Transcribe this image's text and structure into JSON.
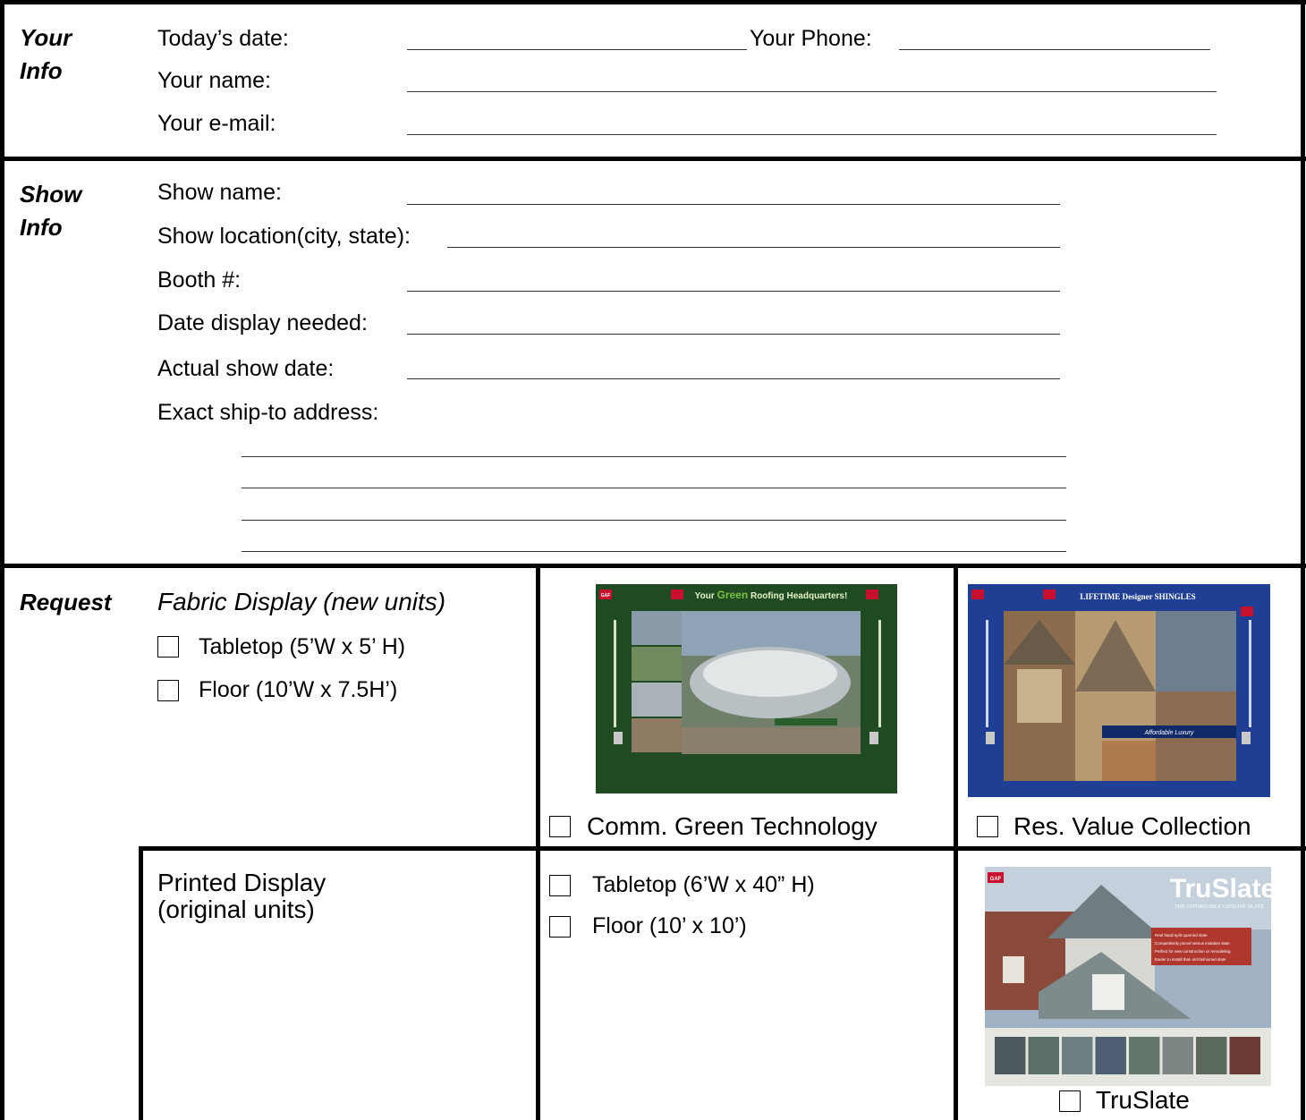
{
  "your_info": {
    "label": "Your\nInfo",
    "todays_date": "Today’s date:",
    "your_phone": "Your Phone:",
    "your_name": "Your name:",
    "your_email": "Your e-mail:"
  },
  "show_info": {
    "label": "Show\nInfo",
    "show_name": "Show name:",
    "show_location": "Show location(city, state):",
    "booth": "Booth #:",
    "date_display_needed": "Date display needed:",
    "actual_show_date": "Actual show date:",
    "ship_to": "Exact ship-to address:"
  },
  "request": {
    "label": "Request",
    "fabric_heading": "Fabric Display (new units)",
    "fabric_options": [
      "Tabletop (5’W x 5’ H)",
      "Floor (10’W x 7.5H’)"
    ],
    "green_caption": "Comm. Green Technology",
    "green_poster": {
      "title_prefix": "Your ",
      "title_em": "Green",
      "title_suffix": " Roofing Headquarters!",
      "logo": "GAF",
      "colors": {
        "bg": "#1f4a22",
        "accent": "#7bc043"
      }
    },
    "value_caption": "Res. Value Collection",
    "value_poster": {
      "title": "LIFETIME Designer SHINGLES",
      "band": "Affordable Luxury",
      "logo": "GAF",
      "colors": {
        "bg": "#1e3f94"
      }
    },
    "printed_heading": "Printed Display\n(original units)",
    "printed_options": [
      "Tabletop (6’W x 40” H)",
      "Floor (10’ x 10’)"
    ],
    "truslate_caption": "TruSlate",
    "truslate_poster": {
      "brand": "TruSlate",
      "tagline": "THE AFFORDABLE GENUINE SLATE",
      "logo": "GAF",
      "bullets": [
        "Real hand-split quarried slate",
        "Competitively priced versus imitation slate",
        "Perfect for new construction or remodeling",
        "Easier to install than old-fashioned slate"
      ],
      "swatch_colors": [
        "#4c5a5e",
        "#5a6e6a",
        "#6e7f83",
        "#4f5f73",
        "#65776a",
        "#7c8584",
        "#5b6a5d",
        "#6b3b34"
      ]
    }
  }
}
